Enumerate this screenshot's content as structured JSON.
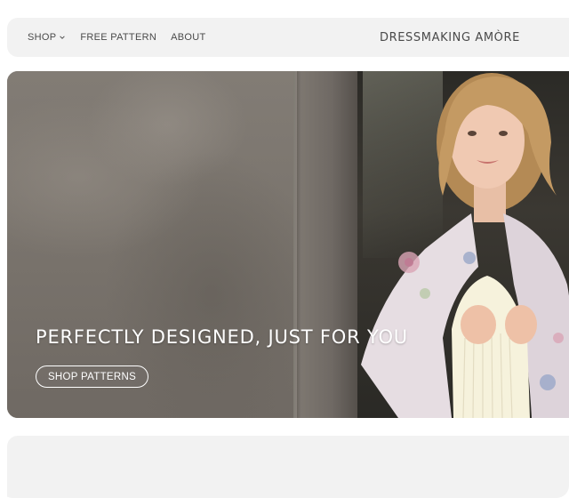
{
  "header": {
    "nav": [
      {
        "label": "SHOP",
        "has_dropdown": true
      },
      {
        "label": "FREE PATTERN",
        "has_dropdown": false
      },
      {
        "label": "ABOUT",
        "has_dropdown": false
      }
    ],
    "brand": "DRESSMAKING AMÒRE"
  },
  "hero": {
    "title": "PERFECTLY DESIGNED, JUST FOR YOU",
    "button_label": "SHOP PATTERNS"
  },
  "icons": {
    "shop_dropdown": "chevron-down-icon"
  },
  "colors": {
    "header_bg": "#f2f2f2",
    "text_dark": "#4a4a4a",
    "hero_text": "#ffffff"
  }
}
